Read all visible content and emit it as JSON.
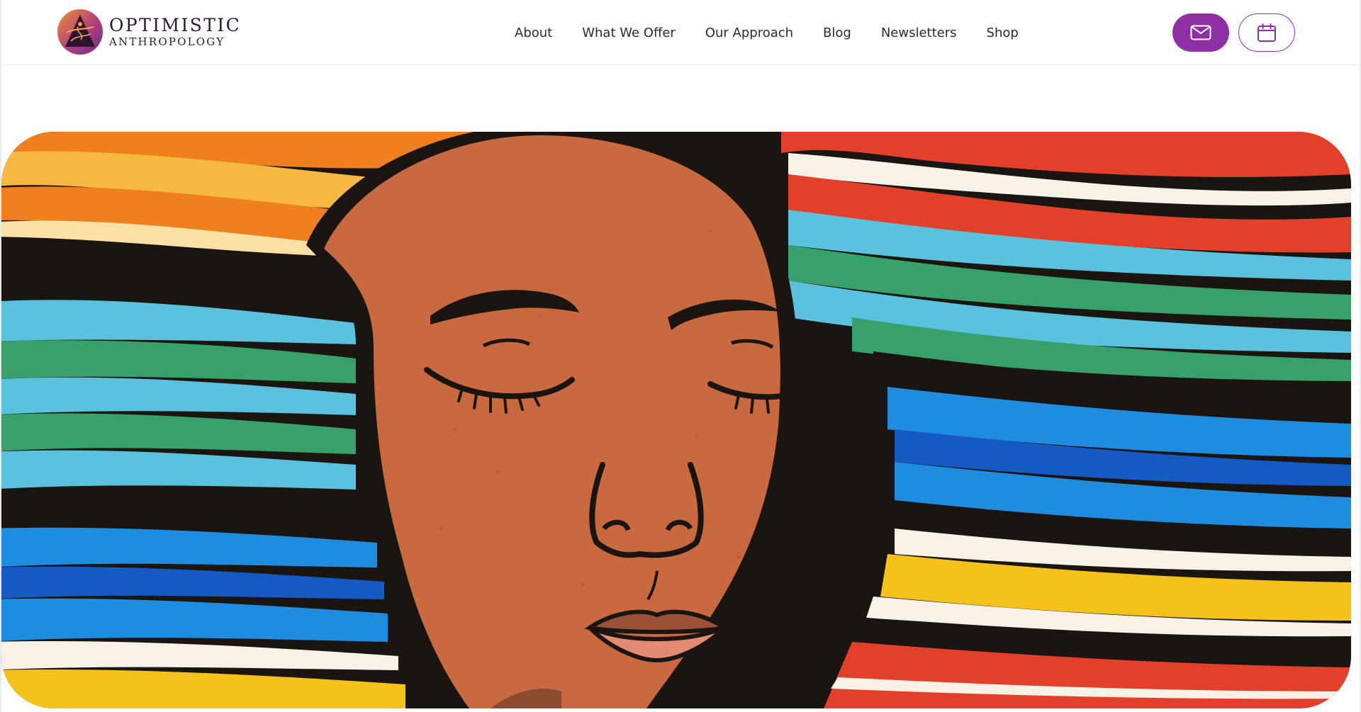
{
  "brand": {
    "name_line1": "OPTIMISTIC",
    "name_line2": "ANTHROPOLOGY",
    "mark_colors": [
      "#e8862a",
      "#7a2a8c",
      "#2b1533"
    ]
  },
  "nav": {
    "items": [
      {
        "label": "About"
      },
      {
        "label": "What We Offer"
      },
      {
        "label": "Our Approach"
      },
      {
        "label": "Blog"
      },
      {
        "label": "Newsletters"
      },
      {
        "label": "Shop"
      }
    ]
  },
  "actions": {
    "mail_icon": "envelope-icon",
    "calendar_icon": "calendar-icon"
  },
  "theme": {
    "accent": "#8e2fa3",
    "text": "#2a2a2a"
  },
  "hero": {
    "subject": "mural-woman-closed-eyes",
    "palette": [
      "#c8693f",
      "#f07f1e",
      "#5bc2dd",
      "#38a06a",
      "#1e8de0",
      "#f4c21b",
      "#e2402b",
      "#f7f1e6",
      "#1b1512"
    ]
  }
}
